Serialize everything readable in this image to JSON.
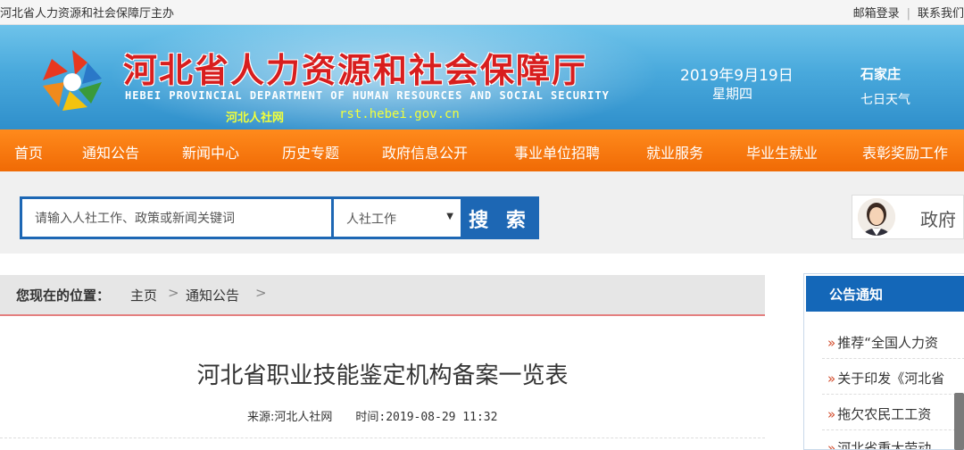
{
  "topbar": {
    "sponsor": "河北省人力资源和社会保障厅主办",
    "email_login": "邮箱登录",
    "separator": "|",
    "contact": "联系我们"
  },
  "header": {
    "title": "河北省人力资源和社会保障厅",
    "title_en": "HEBEI PROVINCIAL DEPARTMENT OF HUMAN RESOURCES AND SOCIAL SECURITY",
    "short_name": "河北人社网",
    "url": "rst.hebei.gov.cn",
    "date": "2019年9月19日",
    "weekday": "星期四",
    "city": "石家庄",
    "weather": "七日天气"
  },
  "nav": {
    "items": [
      {
        "label": "首页"
      },
      {
        "label": "通知公告"
      },
      {
        "label": "新闻中心"
      },
      {
        "label": "历史专题"
      },
      {
        "label": "政府信息公开"
      },
      {
        "label": "事业单位招聘"
      },
      {
        "label": "就业服务"
      },
      {
        "label": "毕业生就业"
      },
      {
        "label": "表彰奖励工作"
      }
    ]
  },
  "search": {
    "placeholder": "请输入人社工作、政策或新闻关键词",
    "category": "人社工作",
    "button": "搜 索"
  },
  "service": {
    "label": "政府"
  },
  "breadcrumb": {
    "label": "您现在的位置：",
    "items": [
      "主页",
      "通知公告"
    ],
    "sep": ">"
  },
  "article": {
    "title": "河北省职业技能鉴定机构备案一览表",
    "source": "来源:河北人社网",
    "time": "时间:2019-08-29 11:32"
  },
  "sidebar": {
    "title": "公告通知",
    "marker": "»",
    "items": [
      {
        "text": "推荐“全国人力资"
      },
      {
        "text": "关于印发《河北省"
      },
      {
        "text": "拖欠农民工工资"
      },
      {
        "text": "河北省重大劳动"
      }
    ]
  },
  "colors": {
    "nav_orange": "#f47a10",
    "header_blue": "#49a9dc",
    "title_red": "#d81e1e",
    "search_blue": "#1d67b4",
    "sidebar_blue": "#1467b8"
  }
}
